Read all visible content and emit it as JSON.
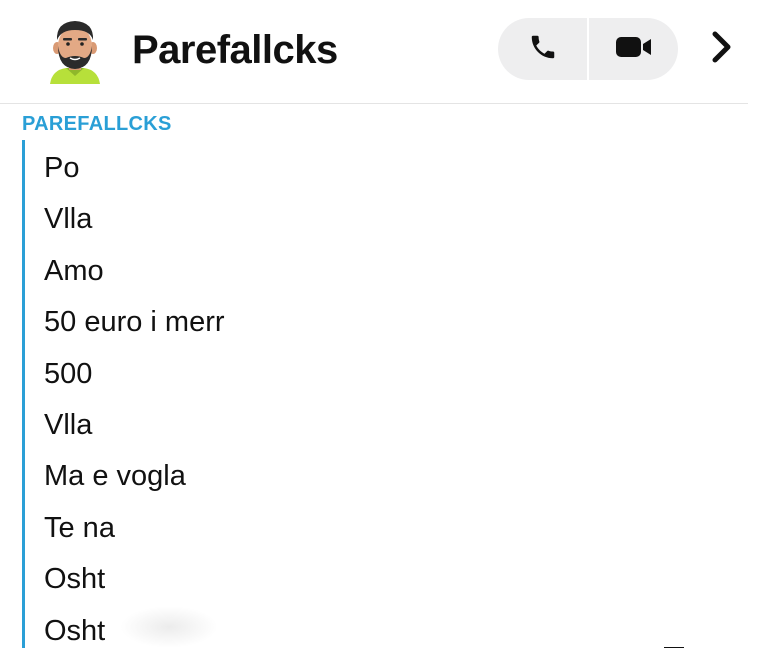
{
  "header": {
    "contact_name": "Parefallcks",
    "avatar_icon": "bitmoji-avatar-icon",
    "audio_call_icon": "phone-icon",
    "video_call_icon": "video-camera-icon",
    "more_icon": "chevron-right-icon"
  },
  "thread": {
    "sender_label": "PAREFALLCKS",
    "accent_color": "#2a9fd6",
    "messages": [
      "Po",
      "Vlla",
      "Amo",
      "50 euro i merr",
      "500",
      "Vlla",
      "Ma e vogla",
      "Te na",
      "Osht",
      "Osht"
    ]
  }
}
